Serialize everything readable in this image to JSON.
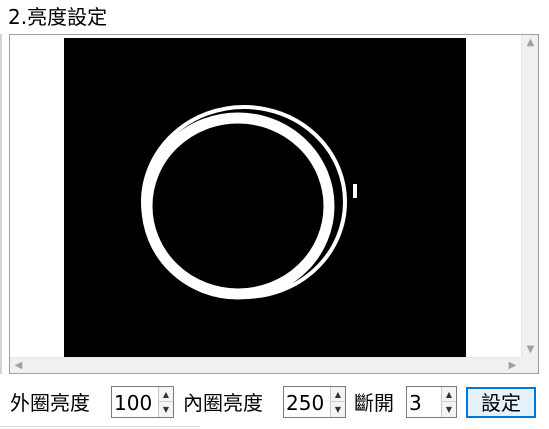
{
  "title": "2.亮度設定",
  "controls": {
    "outer_label": "外圈亮度",
    "outer_value": "100",
    "inner_label": "內圈亮度",
    "inner_value": "250",
    "break_label": "斷開",
    "break_value": "3",
    "set_button": "設定"
  },
  "scrollbars": {
    "up": "▲",
    "down": "▼",
    "left": "◀",
    "right": "▶"
  }
}
